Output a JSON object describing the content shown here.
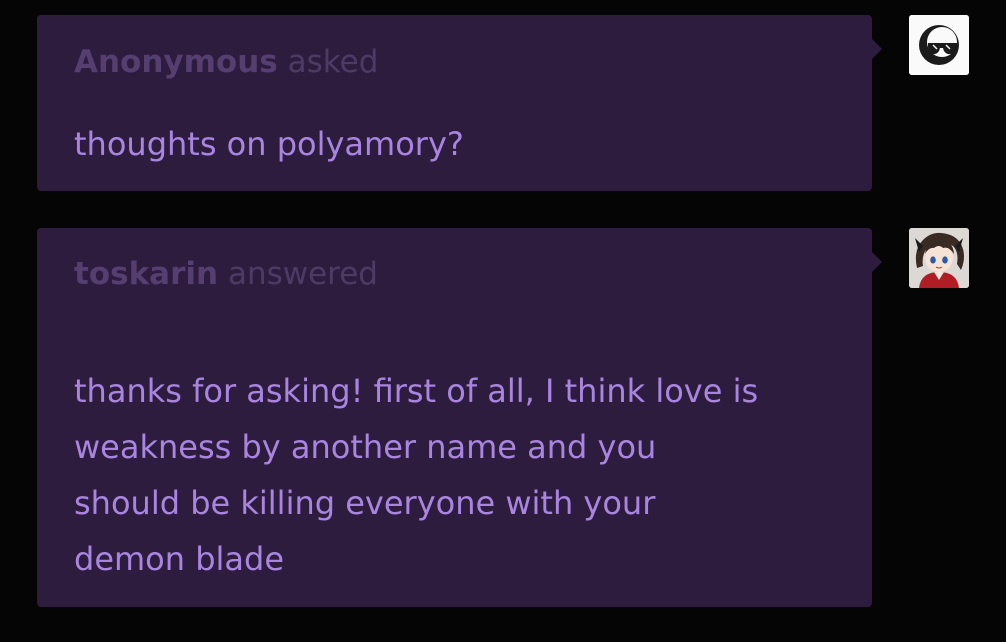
{
  "ask": {
    "asker": "Anonymous",
    "verb": "asked",
    "question": "thoughts on polyamory?"
  },
  "answer": {
    "responder": "toskarin",
    "verb": "answered",
    "lines": [
      "thanks for asking! first of all, I think love is",
      "weakness by another name and you",
      "should be killing everyone with your",
      "demon blade"
    ]
  },
  "avatars": {
    "asker_icon": "anonymous-sunglasses-icon",
    "responder_icon": "anime-character-avatar"
  },
  "colors": {
    "background": "#050505",
    "bubble": "#2e1c3f",
    "text": "#a785e0",
    "byline": "#553e70"
  }
}
